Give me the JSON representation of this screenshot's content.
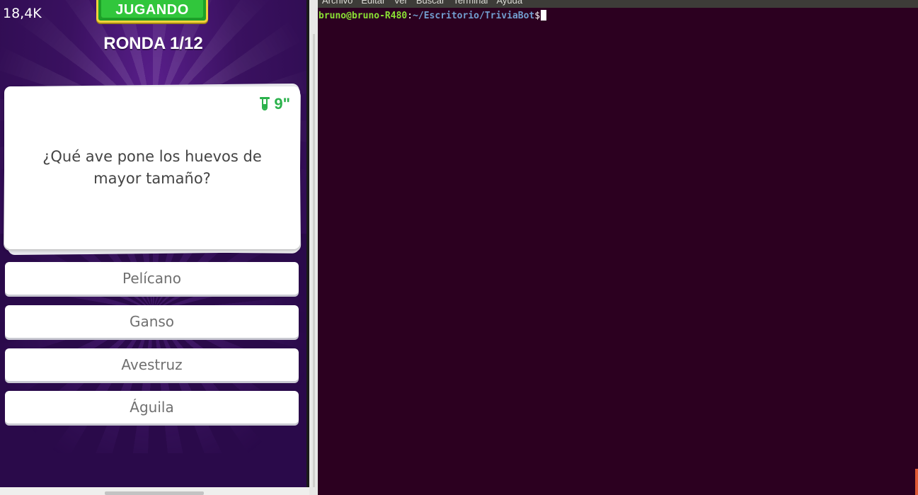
{
  "game": {
    "counter": "18,4K",
    "status_badge": "JUGANDO",
    "round": "RONDA 1/12",
    "timer": "9\"",
    "question": "¿Qué ave pone los huevos de mayor tamaño?",
    "answers": [
      "Pelícano",
      "Ganso",
      "Avestruz",
      "Águila"
    ],
    "colors": {
      "accent_green": "#2bb24c",
      "badge_border": "#f3d23a",
      "background_purple": "#3a1160"
    },
    "icons": [
      "test-tube-icon"
    ]
  },
  "terminal": {
    "menu": [
      "Archivo",
      "Editar",
      "Ver",
      "Buscar",
      "Terminal",
      "Ayuda"
    ],
    "prompt": {
      "user_host": "bruno@bruno-R480",
      "separator": ":",
      "path": "~/Escritorio/TriviaBot",
      "symbol": "$"
    },
    "colors": {
      "background": "#2c0020",
      "user_host": "#8ae234",
      "path": "#729fcf"
    }
  }
}
